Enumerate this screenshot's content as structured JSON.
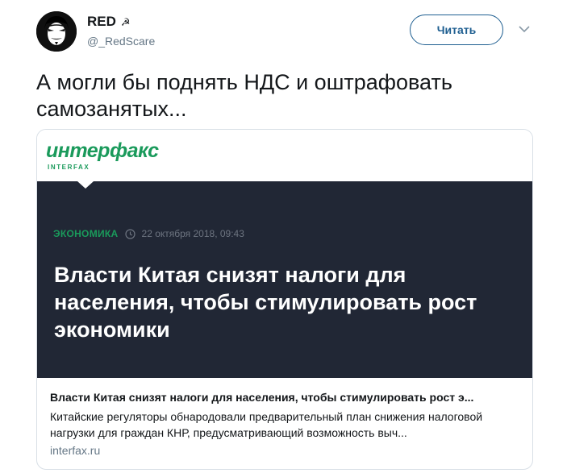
{
  "user": {
    "display_name": "RED",
    "name_icon": "hammer-and-sickle-icon",
    "handle": "@_RedScare"
  },
  "actions": {
    "follow_label": "Читать",
    "more_icon": "chevron-down-icon"
  },
  "tweet": {
    "text": "А могли бы поднять НДС и оштрафовать самозанятых..."
  },
  "card": {
    "logo_text": "интерфакс",
    "logo_subtext": "INTERFAX",
    "category": "ЭКОНОМИКА",
    "date": "22 октября 2018, 09:43",
    "headline": "Власти Китая снизят налоги для населения, чтобы стимулировать рост экономики",
    "title": "Власти Китая снизят налоги для населения, чтобы стимулировать рост э...",
    "description": "Китайские регуляторы обнародовали предварительный план снижения налоговой нагрузки для граждан КНР, предусматривающий возможность выч...",
    "domain": "interfax.ru"
  },
  "colors": {
    "accent": "#1f5f91",
    "interfax_green": "#1a9a5b",
    "dark_panel": "#212735",
    "secondary_text": "#657786"
  }
}
